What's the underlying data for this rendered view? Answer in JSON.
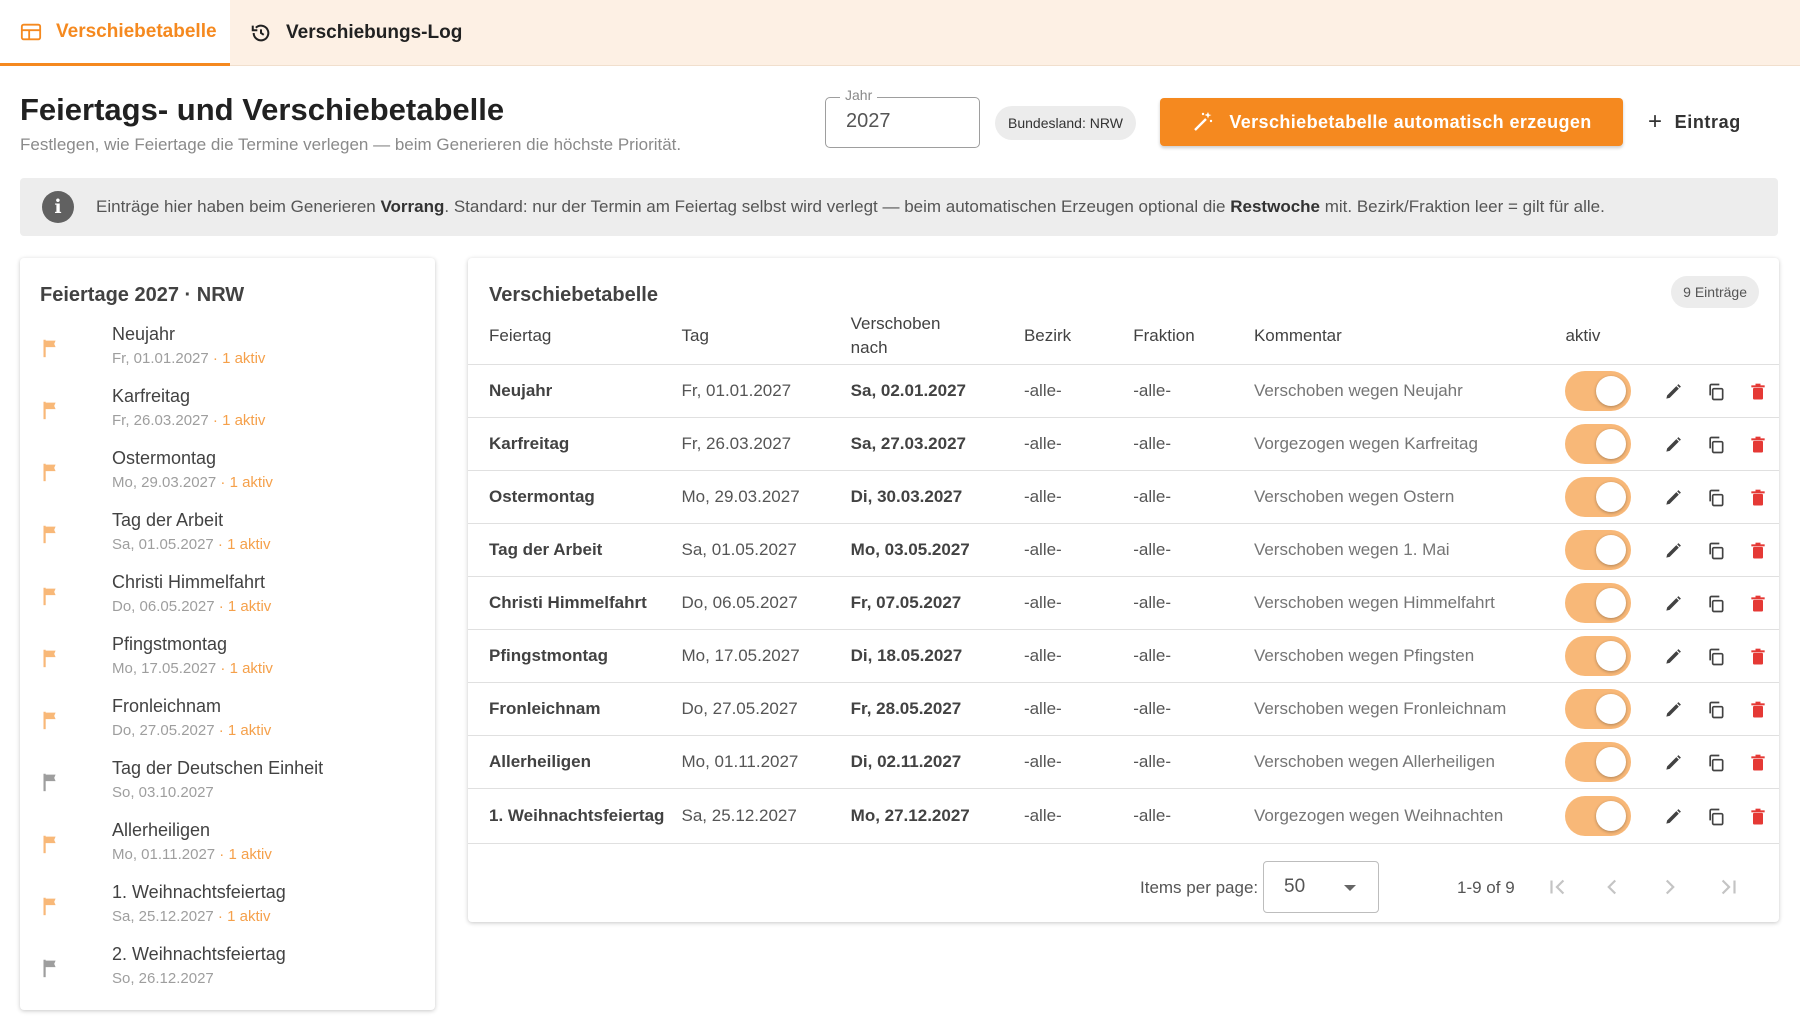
{
  "tabs": {
    "active_label": "Verschiebetabelle",
    "log_label": "Verschiebungs-Log"
  },
  "header": {
    "title": "Feiertags- und Verschiebetabelle",
    "subtitle": "Festlegen, wie Feiertage die Termine verlegen — beim Generieren die höchste Priorität.",
    "year_label": "Jahr",
    "year_value": "2027",
    "bundesland_chip": "Bundesland: NRW",
    "generate_button": "Verschiebetabelle automatisch erzeugen",
    "add_button": "Eintrag"
  },
  "info": {
    "text_1": "Einträge hier haben beim Generieren ",
    "bold_1": "Vorrang",
    "text_2": ". Standard: nur der Termin am Feiertag selbst wird verlegt — beim automatischen Erzeugen optional die ",
    "bold_2": "Restwoche",
    "text_3": " mit. Bezirk/Fraktion leer = gilt für alle."
  },
  "holidays": {
    "title": "Feiertage 2027 · NRW",
    "items": [
      {
        "name": "Neujahr",
        "date": "Fr, 01.01.2027",
        "aktiv": " · 1 aktiv",
        "active": true
      },
      {
        "name": "Karfreitag",
        "date": "Fr, 26.03.2027",
        "aktiv": " · 1 aktiv",
        "active": true
      },
      {
        "name": "Ostermontag",
        "date": "Mo, 29.03.2027",
        "aktiv": " · 1 aktiv",
        "active": true
      },
      {
        "name": "Tag der Arbeit",
        "date": "Sa, 01.05.2027",
        "aktiv": " · 1 aktiv",
        "active": true
      },
      {
        "name": "Christi Himmelfahrt",
        "date": "Do, 06.05.2027",
        "aktiv": " · 1 aktiv",
        "active": true
      },
      {
        "name": "Pfingstmontag",
        "date": "Mo, 17.05.2027",
        "aktiv": " · 1 aktiv",
        "active": true
      },
      {
        "name": "Fronleichnam",
        "date": "Do, 27.05.2027",
        "aktiv": " · 1 aktiv",
        "active": true
      },
      {
        "name": "Tag der Deutschen Einheit",
        "date": "So, 03.10.2027",
        "aktiv": "",
        "active": false
      },
      {
        "name": "Allerheiligen",
        "date": "Mo, 01.11.2027",
        "aktiv": " · 1 aktiv",
        "active": true
      },
      {
        "name": "1. Weihnachtsfeiertag",
        "date": "Sa, 25.12.2027",
        "aktiv": " · 1 aktiv",
        "active": true
      },
      {
        "name": "2. Weihnachtsfeiertag",
        "date": "So, 26.12.2027",
        "aktiv": "",
        "active": false
      }
    ]
  },
  "table": {
    "title": "Verschiebetabelle",
    "count": "9 Einträge",
    "columns": {
      "feiertag": "Feiertag",
      "tag": "Tag",
      "verschoben_1": "Verschoben",
      "verschoben_2": "nach",
      "bezirk": "Bezirk",
      "fraktion": "Fraktion",
      "kommentar": "Kommentar",
      "aktiv": "aktiv"
    },
    "rows": [
      {
        "feiertag": "Neujahr",
        "tag": "Fr, 01.01.2027",
        "verschoben": "Sa, 02.01.2027",
        "bezirk": "-alle-",
        "fraktion": "-alle-",
        "kommentar": "Verschoben wegen Neujahr",
        "aktiv": true
      },
      {
        "feiertag": "Karfreitag",
        "tag": "Fr, 26.03.2027",
        "verschoben": "Sa, 27.03.2027",
        "bezirk": "-alle-",
        "fraktion": "-alle-",
        "kommentar": "Vorgezogen wegen Karfreitag",
        "aktiv": true
      },
      {
        "feiertag": "Ostermontag",
        "tag": "Mo, 29.03.2027",
        "verschoben": "Di, 30.03.2027",
        "bezirk": "-alle-",
        "fraktion": "-alle-",
        "kommentar": "Verschoben wegen Ostern",
        "aktiv": true
      },
      {
        "feiertag": "Tag der Arbeit",
        "tag": "Sa, 01.05.2027",
        "verschoben": "Mo, 03.05.2027",
        "bezirk": "-alle-",
        "fraktion": "-alle-",
        "kommentar": "Verschoben wegen 1. Mai",
        "aktiv": true
      },
      {
        "feiertag": "Christi Himmelfahrt",
        "tag": "Do, 06.05.2027",
        "verschoben": "Fr, 07.05.2027",
        "bezirk": "-alle-",
        "fraktion": "-alle-",
        "kommentar": "Verschoben wegen Himmelfahrt",
        "aktiv": true
      },
      {
        "feiertag": "Pfingstmontag",
        "tag": "Mo, 17.05.2027",
        "verschoben": "Di, 18.05.2027",
        "bezirk": "-alle-",
        "fraktion": "-alle-",
        "kommentar": "Verschoben wegen Pfingsten",
        "aktiv": true
      },
      {
        "feiertag": "Fronleichnam",
        "tag": "Do, 27.05.2027",
        "verschoben": "Fr, 28.05.2027",
        "bezirk": "-alle-",
        "fraktion": "-alle-",
        "kommentar": "Verschoben wegen Fronleichnam",
        "aktiv": true
      },
      {
        "feiertag": "Allerheiligen",
        "tag": "Mo, 01.11.2027",
        "verschoben": "Di, 02.11.2027",
        "bezirk": "-alle-",
        "fraktion": "-alle-",
        "kommentar": "Verschoben wegen Allerheiligen",
        "aktiv": true
      },
      {
        "feiertag": "1. Weihnachtsfeiertag",
        "tag": "Sa, 25.12.2027",
        "verschoben": "Mo, 27.12.2027",
        "bezirk": "-alle-",
        "fraktion": "-alle-",
        "kommentar": "Vorgezogen wegen Weihnachten",
        "aktiv": true
      }
    ]
  },
  "paginator": {
    "items_per_page_label": "Items per page:",
    "items_per_page_value": "50",
    "range": "1-9 of 9"
  },
  "colors": {
    "accent": "#f5891f",
    "accent_light": "#f8b878",
    "tabbar_bg": "#fdf0e4",
    "delete_red": "#e53935",
    "flag_inactive": "#9e9e9e"
  },
  "icons": {
    "tab_table": "table-icon",
    "tab_log": "history-icon",
    "generate": "magic-wand-icon",
    "add": "plus-icon",
    "info": "info-icon",
    "holiday": "flag-icon",
    "edit": "pencil-icon",
    "copy": "copy-icon",
    "delete": "trash-icon"
  }
}
